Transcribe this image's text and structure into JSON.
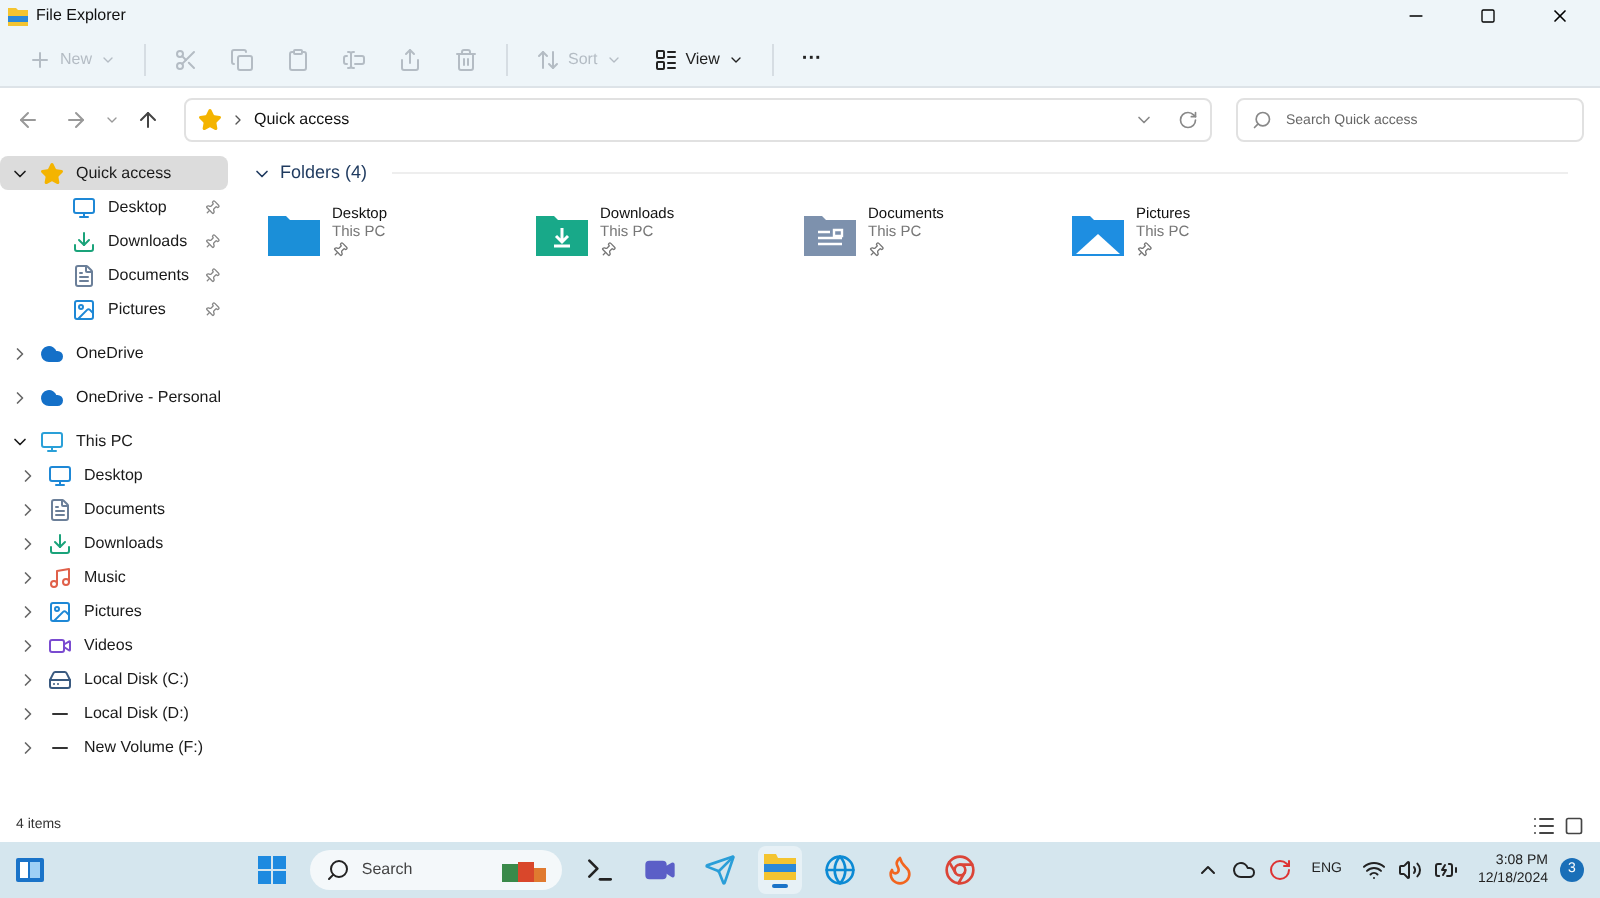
{
  "window": {
    "title": "File Explorer"
  },
  "toolbar": [
    {
      "kind": "new",
      "label": "New",
      "disabled": true
    },
    {
      "kind": "cut",
      "disabled": true
    },
    {
      "kind": "copy",
      "disabled": true
    },
    {
      "kind": "paste",
      "disabled": true
    },
    {
      "kind": "rename",
      "disabled": true
    },
    {
      "kind": "share",
      "disabled": true
    },
    {
      "kind": "delete",
      "disabled": true
    },
    {
      "kind": "sort",
      "label": "Sort",
      "disabled": true
    },
    {
      "kind": "view",
      "label": "View",
      "disabled": false
    },
    {
      "kind": "more",
      "label": "···",
      "disabled": false
    }
  ],
  "address": {
    "path": "Quick access"
  },
  "search": {
    "placeholder": "Search Quick access"
  },
  "sidebar": {
    "items": [
      {
        "label": "Quick access",
        "kind": "star",
        "expanded": true,
        "selected": true,
        "children": [
          {
            "label": "Desktop",
            "kind": "desktop",
            "pinned": true,
            "selected": false
          },
          {
            "label": "Downloads",
            "kind": "downloads",
            "pinned": true,
            "selected": false
          },
          {
            "label": "Documents",
            "kind": "documents",
            "pinned": true,
            "selected": false
          },
          {
            "label": "Pictures",
            "kind": "pictures",
            "pinned": true,
            "selected": false
          }
        ]
      },
      {
        "label": "OneDrive",
        "kind": "cloud",
        "expanded": false,
        "selected": false
      },
      {
        "label": "OneDrive - Personal",
        "kind": "cloud",
        "expanded": false,
        "selected": false
      },
      {
        "label": "This PC",
        "kind": "pc",
        "expanded": true,
        "selected": false,
        "children": [
          {
            "label": "Desktop",
            "kind": "desktop",
            "expanded": false,
            "selected": false
          },
          {
            "label": "Documents",
            "kind": "documents",
            "expanded": false,
            "selected": false
          },
          {
            "label": "Downloads",
            "kind": "downloads",
            "expanded": false,
            "selected": false
          },
          {
            "label": "Music",
            "kind": "music",
            "expanded": false,
            "selected": false
          },
          {
            "label": "Pictures",
            "kind": "pictures",
            "expanded": false,
            "selected": false
          },
          {
            "label": "Videos",
            "kind": "videos",
            "expanded": false,
            "selected": false
          },
          {
            "label": "Local Disk (C:)",
            "kind": "drive_c",
            "expanded": false,
            "selected": false
          },
          {
            "label": "Local Disk (D:)",
            "kind": "drive",
            "expanded": false,
            "selected": false
          },
          {
            "label": "New Volume (F:)",
            "kind": "drive",
            "expanded": false,
            "selected": false
          }
        ]
      }
    ]
  },
  "content": {
    "group": {
      "title": "Folders (4)",
      "expanded": true
    },
    "folders": [
      {
        "name": "Desktop",
        "location": "This PC",
        "kind": "desktop",
        "pinned": true
      },
      {
        "name": "Downloads",
        "location": "This PC",
        "kind": "downloads",
        "pinned": true
      },
      {
        "name": "Documents",
        "location": "This PC",
        "kind": "documents",
        "pinned": true
      },
      {
        "name": "Pictures",
        "location": "This PC",
        "kind": "pictures",
        "pinned": true
      }
    ]
  },
  "status_bar": {
    "text": "4 items"
  },
  "taskbar": {
    "search_placeholder": "Search",
    "apps": [
      {
        "kind": "terminal",
        "active": false
      },
      {
        "kind": "meet",
        "active": false
      },
      {
        "kind": "telegram",
        "active": false
      },
      {
        "kind": "explorer",
        "active": true
      },
      {
        "kind": "edge",
        "active": false
      },
      {
        "kind": "firefox",
        "active": false
      },
      {
        "kind": "chrome",
        "active": false
      }
    ],
    "language": "ENG",
    "time": "3:08 PM",
    "date": "12/18/2024",
    "notifications": "3"
  }
}
